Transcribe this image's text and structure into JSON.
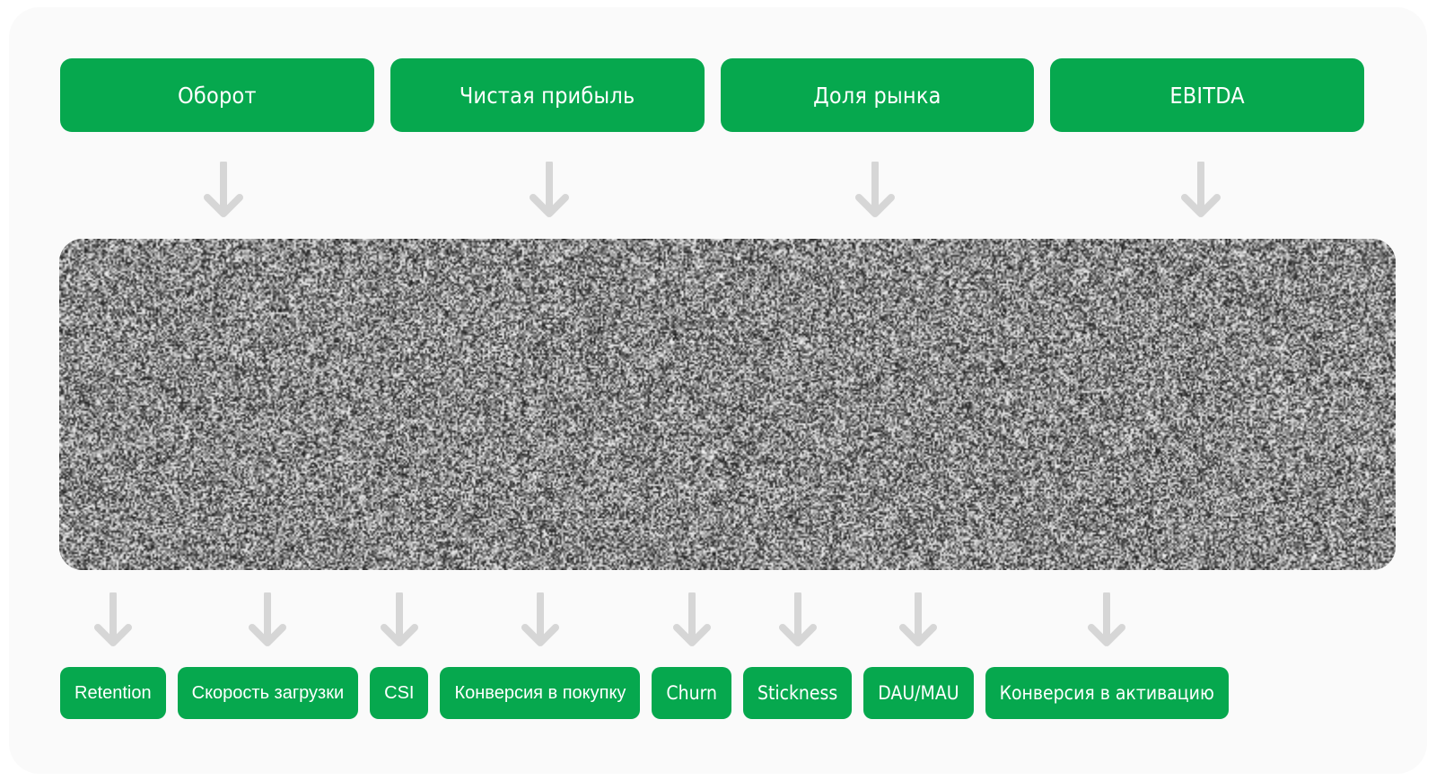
{
  "diagram": {
    "accent_color": "#06a84e",
    "arrow_color": "#d6d6d6",
    "card_background": "#fafafa",
    "page_background": "#ffffff",
    "top_row": {
      "items": [
        {
          "label": "Оборот"
        },
        {
          "label": "Чистая прибыль"
        },
        {
          "label": "Доля рынка"
        },
        {
          "label": "EBITDA"
        }
      ]
    },
    "top_arrows": [
      {
        "icon": "arrow-down-icon"
      },
      {
        "icon": "arrow-down-icon"
      },
      {
        "icon": "arrow-down-icon"
      },
      {
        "icon": "arrow-down-icon"
      }
    ],
    "middle_block": {
      "type": "redacted-noise-panel",
      "label": ""
    },
    "bottom_arrows": [
      {
        "icon": "arrow-down-icon"
      },
      {
        "icon": "arrow-down-icon"
      },
      {
        "icon": "arrow-down-icon"
      },
      {
        "icon": "arrow-down-icon"
      },
      {
        "icon": "arrow-down-icon"
      },
      {
        "icon": "arrow-down-icon"
      },
      {
        "icon": "arrow-down-icon"
      },
      {
        "icon": "arrow-down-icon"
      }
    ],
    "bottom_row": {
      "items": [
        {
          "label": "Retention",
          "condensed": false
        },
        {
          "label": "Скорость загрузки",
          "condensed": false
        },
        {
          "label": "CSI",
          "condensed": false
        },
        {
          "label": "Конверсия в покупку",
          "condensed": false
        },
        {
          "label": "Churn",
          "condensed": true
        },
        {
          "label": "Stickness",
          "condensed": true
        },
        {
          "label": "DAU/MAU",
          "condensed": true
        },
        {
          "label": "Конверсия в активацию",
          "condensed": true
        }
      ]
    }
  }
}
